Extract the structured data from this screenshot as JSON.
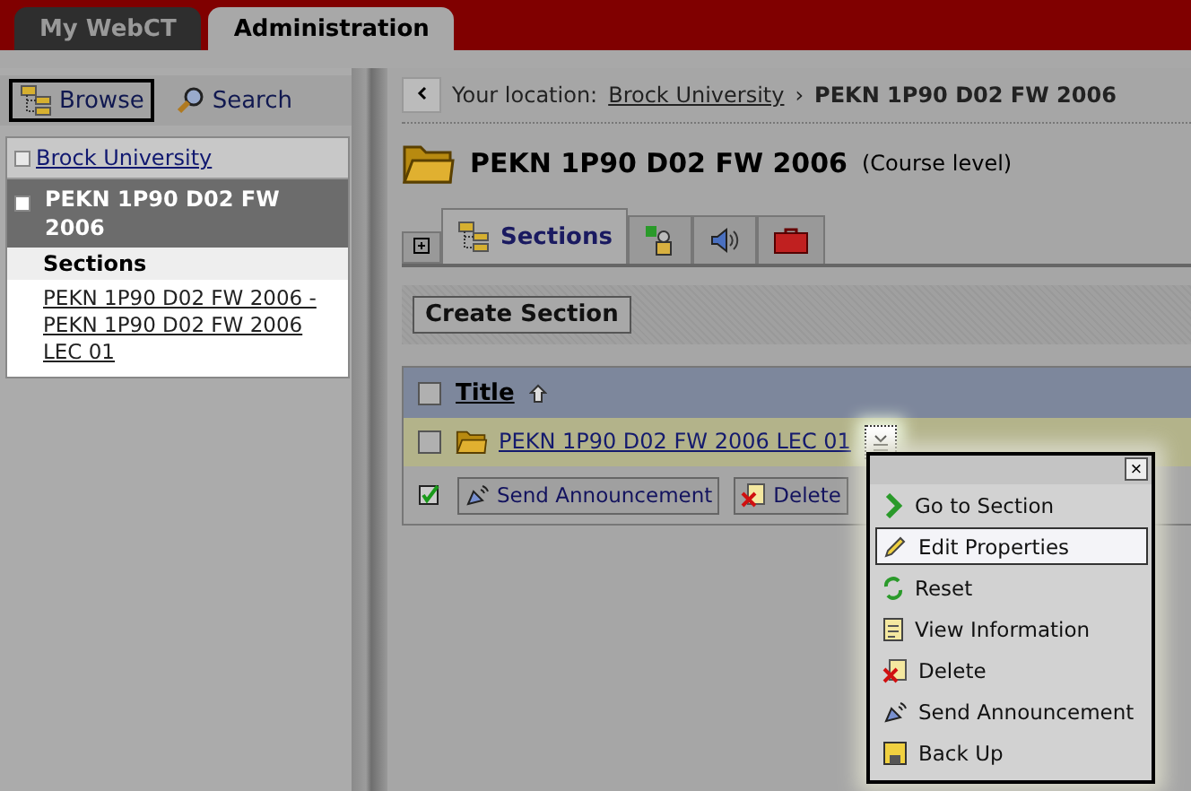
{
  "top_tabs": [
    {
      "label": "My WebCT",
      "selected": false
    },
    {
      "label": "Administration",
      "selected": true
    }
  ],
  "sidebar": {
    "modes": [
      {
        "kind": "browse",
        "label": "Browse",
        "selected": true
      },
      {
        "kind": "search",
        "label": "Search",
        "selected": false
      }
    ],
    "root": "Brock University",
    "course": {
      "label": "PEKN 1P90 D02 FW 2006",
      "selected": true
    },
    "heading": "Sections",
    "leaves": [
      "PEKN 1P90 D02 FW 2006 - PEKN 1P90 D02 FW 2006 LEC 01"
    ]
  },
  "breadcrumb": {
    "prefix": "Your location:",
    "link": "Brock University",
    "separator": "›",
    "current": "PEKN 1P90 D02 FW 2006"
  },
  "course": {
    "title": "PEKN 1P90 D02 FW 2006",
    "level": "(Course level)"
  },
  "tabs": [
    {
      "kind": "sections",
      "label": "Sections",
      "selected": true
    },
    {
      "kind": "people",
      "selected": false
    },
    {
      "kind": "speaker",
      "selected": false
    },
    {
      "kind": "toolbox",
      "selected": false
    }
  ],
  "create_button": "Create Section",
  "table": {
    "column": "Title",
    "all_checked": false,
    "rows": [
      {
        "title": "PEKN 1P90 D02 FW 2006 LEC 01",
        "checked": false
      }
    ]
  },
  "actions": [
    {
      "kind": "announce",
      "label": "Send Announcement"
    },
    {
      "kind": "delete",
      "label": "Delete"
    }
  ],
  "menu": {
    "close": "×",
    "items": [
      {
        "kind": "go",
        "label": "Go to Section",
        "selected": false
      },
      {
        "kind": "edit",
        "label": "Edit Properties",
        "selected": true
      },
      {
        "kind": "reset",
        "label": "Reset",
        "selected": false
      },
      {
        "kind": "info",
        "label": "View Information",
        "selected": false
      },
      {
        "kind": "delete",
        "label": "Delete",
        "selected": false
      },
      {
        "kind": "announce",
        "label": "Send Announcement",
        "selected": false
      },
      {
        "kind": "backup",
        "label": "Back Up",
        "selected": false
      }
    ]
  }
}
